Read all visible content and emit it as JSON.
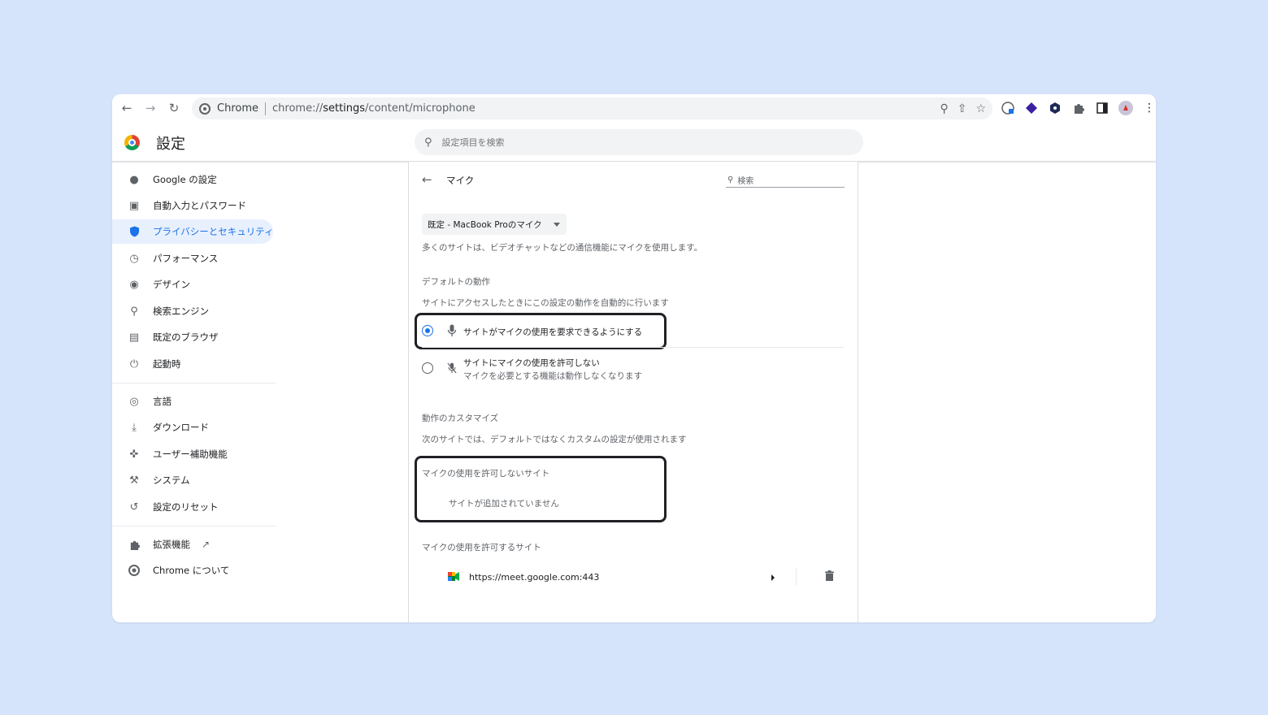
{
  "browser": {
    "omnibox_site": "Chrome",
    "url_prefix": "chrome://",
    "url_host": "settings",
    "url_path": "/content/microphone"
  },
  "header": {
    "title": "設定",
    "search_placeholder": "設定項目を検索"
  },
  "sidebar": {
    "items": [
      {
        "label": "Google の設定"
      },
      {
        "label": "自動入力とパスワード"
      },
      {
        "label": "プライバシーとセキュリティ"
      },
      {
        "label": "パフォーマンス"
      },
      {
        "label": "デザイン"
      },
      {
        "label": "検索エンジン"
      },
      {
        "label": "既定のブラウザ"
      },
      {
        "label": "起動時"
      },
      {
        "label": "言語"
      },
      {
        "label": "ダウンロード"
      },
      {
        "label": "ユーザー補助機能"
      },
      {
        "label": "システム"
      },
      {
        "label": "設定のリセット"
      },
      {
        "label": "拡張機能"
      },
      {
        "label": "Chrome について"
      }
    ]
  },
  "page": {
    "title": "マイク",
    "search_label": "検索",
    "device_select": "既定 - MacBook Proのマイク",
    "description": "多くのサイトは、ビデオチャットなどの通信機能にマイクを使用します。",
    "default_behavior": {
      "heading": "デフォルトの動作",
      "subheading": "サイトにアクセスしたときにこの設定の動作を自動的に行います",
      "option_allow": "サイトがマイクの使用を要求できるようにする",
      "option_block": "サイトにマイクの使用を許可しない",
      "option_block_sub": "マイクを必要とする機能は動作しなくなります"
    },
    "custom": {
      "heading": "動作のカスタマイズ",
      "subheading": "次のサイトでは、デフォルトではなくカスタムの設定が使用されます",
      "blocked_heading": "マイクの使用を許可しないサイト",
      "blocked_empty": "サイトが追加されていません",
      "allowed_heading": "マイクの使用を許可するサイト",
      "allowed_sites": [
        {
          "url": "https://meet.google.com:443"
        }
      ]
    }
  }
}
